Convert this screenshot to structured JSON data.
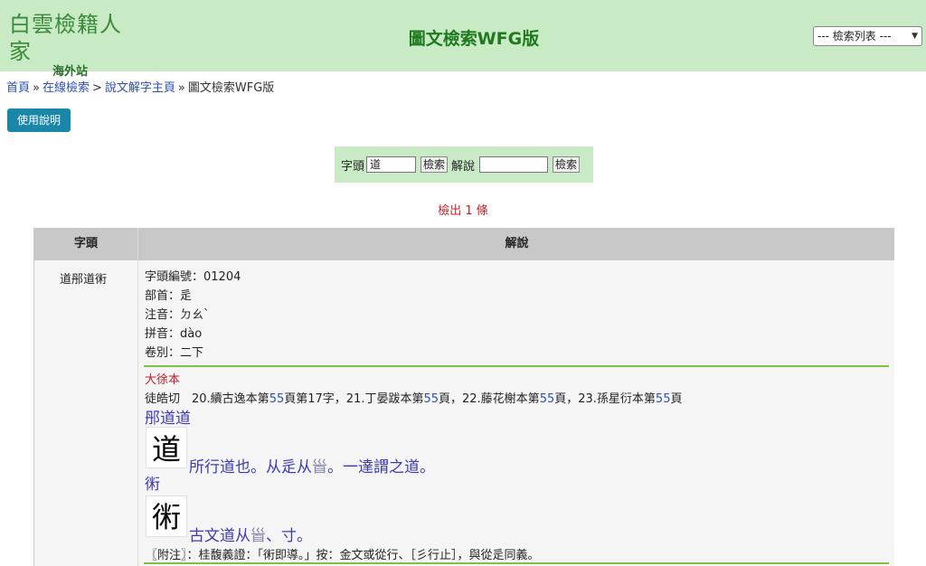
{
  "header": {
    "logo_text": "白雲檢籍人家",
    "logo_sub": "海外站",
    "title": "圖文檢索WFG版",
    "select_label": "--- 檢索列表 ---"
  },
  "breadcrumb": {
    "home": "首頁",
    "online": "在線檢索",
    "shuowen": "說文解字主頁",
    "current": "圖文檢索WFG版",
    "sep": "»",
    "sep2": ">"
  },
  "help_button": "使用說明",
  "search": {
    "head_label": "字頭",
    "head_value": "道",
    "btn1": "檢索",
    "expl_label": "解說",
    "expl_value": "",
    "btn2": "檢索"
  },
  "result_count": "檢出 1 條",
  "table": {
    "col1_header": "字頭",
    "col2_header": "解說",
    "row": {
      "head_chars": "道䢷道𧗱",
      "code": "字頭編號：01204",
      "radical": "部首：辵",
      "zhuyin": "注音：ㄉㄠˋ",
      "pinyin": "拼音：dào",
      "volume": "卷別：二下",
      "edition": "大徐本",
      "cite": {
        "a": "徒皓切　20.續古逸本第",
        "n1": "55",
        "b": "頁第17字，21.丁晏跋本第",
        "n2": "55",
        "c": "頁，22.藤花榭本第",
        "n3": "55",
        "d": "頁，23.孫星衍本第",
        "n4": "55",
        "e": "頁"
      },
      "heading1": "䢷道道",
      "seal1": "道",
      "text1": {
        "a": "所行道也。从辵从",
        "g": "𩠐",
        "b": "。一達謂之道。"
      },
      "heading2": "𧗱",
      "seal2": "𧗱",
      "text2": {
        "a": "古文道从",
        "g": "𩠐",
        "b": "、寸。"
      },
      "note": "〖附注〗：桂馥義證：「𧗱即導。」按：金文或從行、［彡行止］，與從辵同義。"
    }
  }
}
